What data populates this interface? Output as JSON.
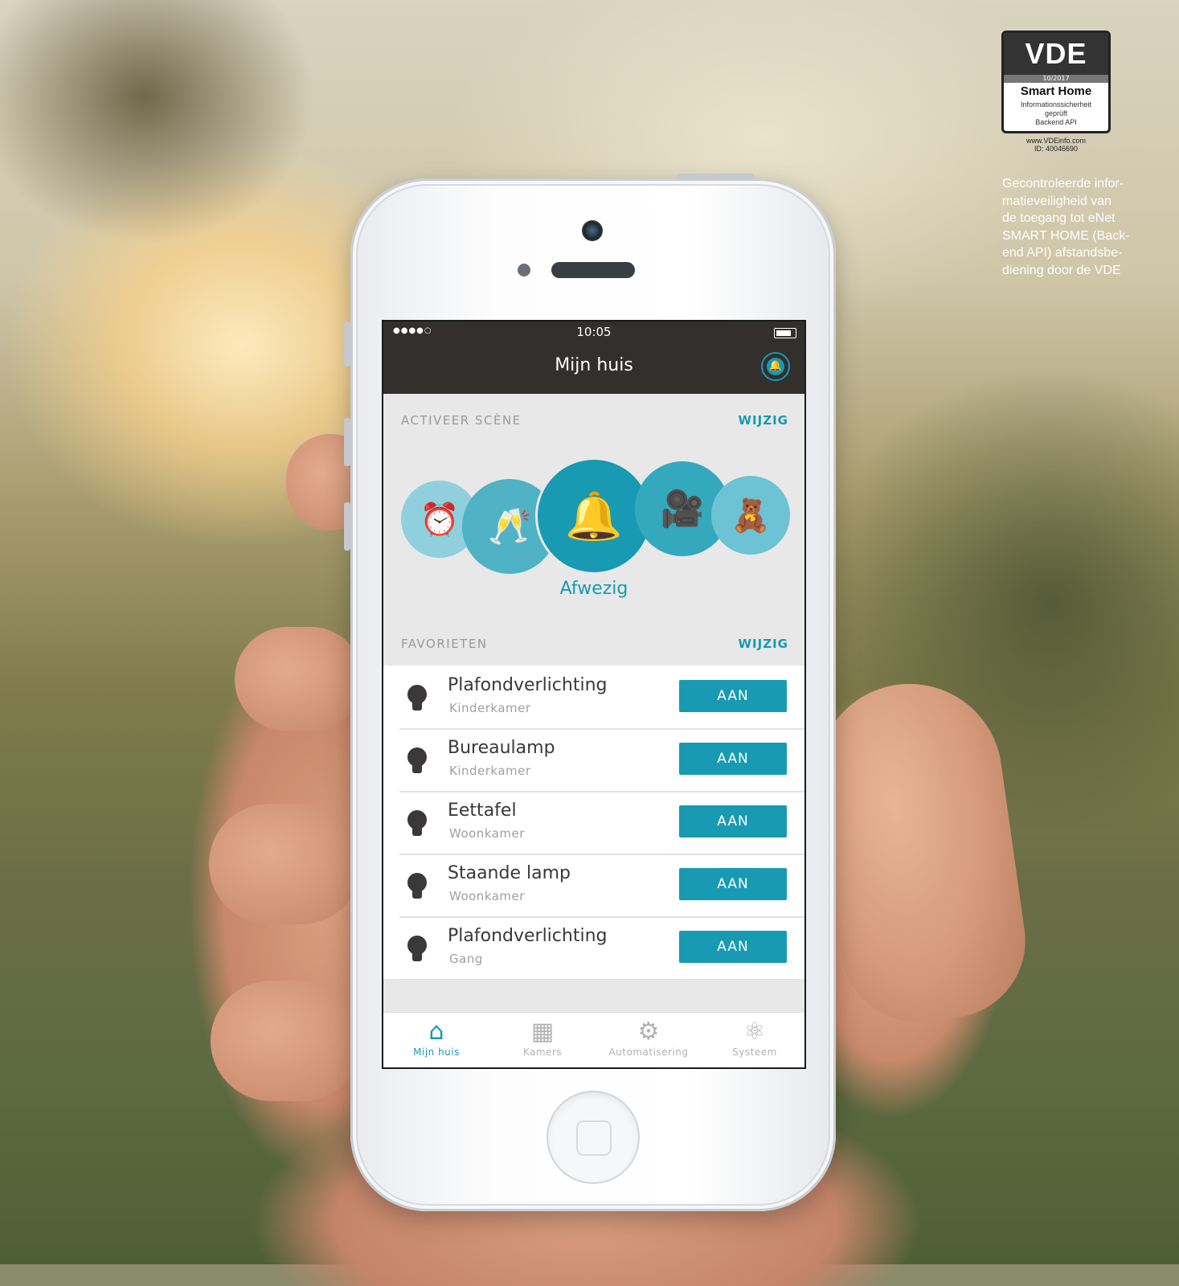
{
  "badge": {
    "brand": "VDE",
    "date": "10/2017",
    "title": "Smart Home",
    "line1": "Informationssicherheit",
    "line2": "geprüft",
    "line3": "Backend API",
    "site": "www.VDEinfo.com",
    "id": "ID: 40046690"
  },
  "caption": "Gecontroleerde infor-\nmatieveiligheid van\nde toegang tot eNet\nSMART HOME (Back-\nend API) afstandsbe-\ndiening door de VDE",
  "status": {
    "dots": "●●●●○",
    "time": "10:05"
  },
  "nav": {
    "title": "Mijn huis",
    "bell_icon": "bell-icon"
  },
  "scenes": {
    "label": "ACTIVEER SCÈNE",
    "edit": "WIJZIG",
    "items": [
      {
        "icon": "alarm-clock-icon",
        "glyph": "⏰"
      },
      {
        "icon": "wine-glasses-icon",
        "glyph": "🥂"
      },
      {
        "icon": "alarm-siren-icon",
        "glyph": "🔔"
      },
      {
        "icon": "video-camera-icon",
        "glyph": "🎥"
      },
      {
        "icon": "teddy-bear-icon",
        "glyph": "🧸"
      }
    ],
    "active_name": "Afwezig"
  },
  "favorites": {
    "label": "FAVORIETEN",
    "edit": "WIJZIG",
    "items": [
      {
        "name": "Plafondverlichting",
        "room": "Kinderkamer",
        "button": "AAN"
      },
      {
        "name": "Bureaulamp",
        "room": "Kinderkamer",
        "button": "AAN"
      },
      {
        "name": "Eettafel",
        "room": "Woonkamer",
        "button": "AAN"
      },
      {
        "name": "Staande lamp",
        "room": "Woonkamer",
        "button": "AAN"
      },
      {
        "name": "Plafondverlichting",
        "room": "Gang",
        "button": "AAN"
      }
    ]
  },
  "tabs": [
    {
      "label": "Mijn huis",
      "icon": "home-icon",
      "glyph": "⌂",
      "active": true
    },
    {
      "label": "Kamers",
      "icon": "rooms-icon",
      "glyph": "▦",
      "active": false
    },
    {
      "label": "Automatisering",
      "icon": "robot-icon",
      "glyph": "⚙",
      "active": false
    },
    {
      "label": "Systeem",
      "icon": "network-icon",
      "glyph": "⚛",
      "active": false
    }
  ],
  "colors": {
    "accent": "#179ab2",
    "navbar": "#322f2d",
    "bulb": "#3a3838"
  }
}
